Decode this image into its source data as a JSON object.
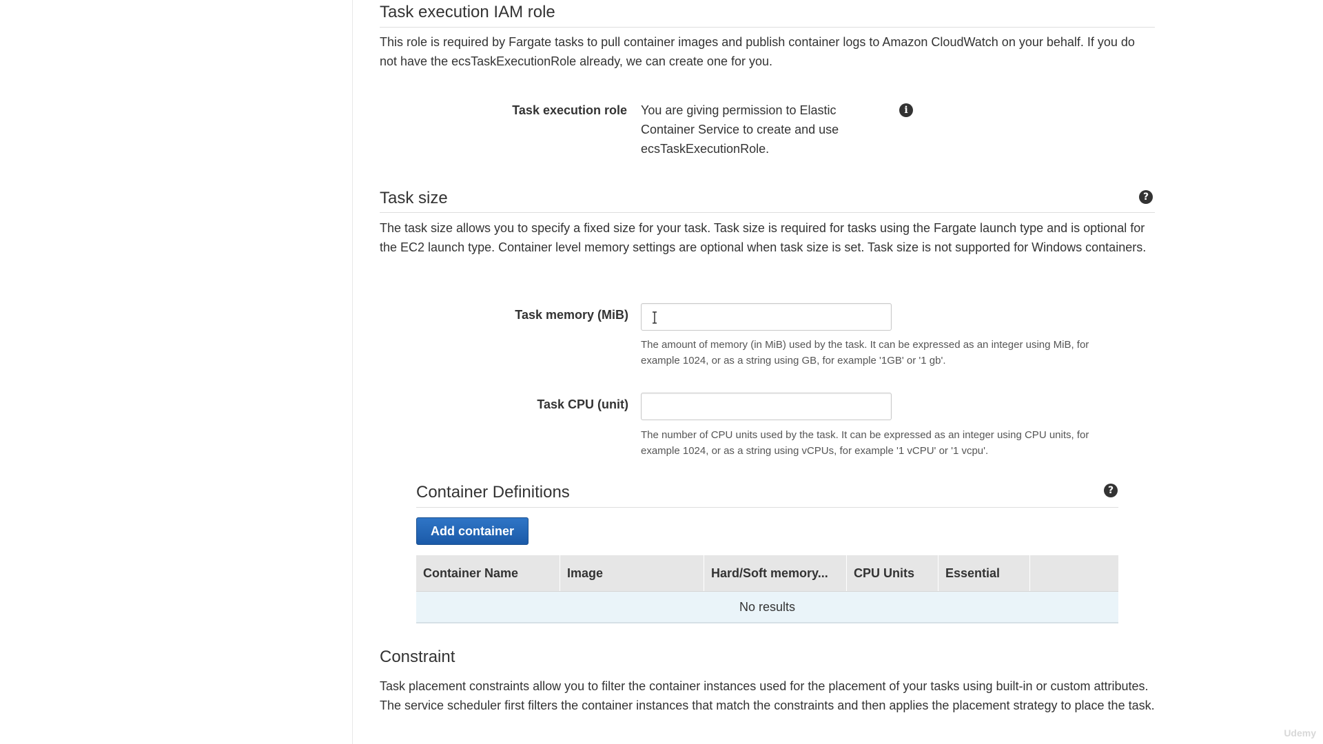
{
  "iam_section": {
    "heading": "Task execution IAM role",
    "description": "This role is required by Fargate tasks to pull container images and publish container logs to Amazon CloudWatch on your behalf. If you do not have the ecsTaskExecutionRole already, we can create one for you.",
    "role_label": "Task execution role",
    "role_text": "You are giving permission to Elastic Container Service to create and use ecsTaskExecutionRole.",
    "info_icon": "info-icon"
  },
  "task_size": {
    "heading": "Task size",
    "help_icon": "help-icon",
    "description": "The task size allows you to specify a fixed size for your task. Task size is required for tasks using the Fargate launch type and is optional for the EC2 launch type. Container level memory settings are optional when task size is set. Task size is not supported for Windows containers.",
    "memory": {
      "label": "Task memory (MiB)",
      "value": "",
      "help": "The amount of memory (in MiB) used by the task. It can be expressed as an integer using MiB, for example 1024, or as a string using GB, for example '1GB' or '1 gb'."
    },
    "cpu": {
      "label": "Task CPU (unit)",
      "value": "",
      "help": "The number of CPU units used by the task. It can be expressed as an integer using CPU units, for example 1024, or as a string using vCPUs, for example '1 vCPU' or '1 vcpu'."
    }
  },
  "container_definitions": {
    "heading": "Container Definitions",
    "help_icon": "help-icon",
    "add_button": "Add container",
    "columns": [
      "Container Name",
      "Image",
      "Hard/Soft memory...",
      "CPU Units",
      "Essential",
      ""
    ],
    "empty_text": "No results"
  },
  "constraint": {
    "heading": "Constraint",
    "description": "Task placement constraints allow you to filter the container instances used for the placement of your tasks using built-in or custom attributes. The service scheduler first filters the container instances that match the constraints and then applies the placement strategy to place the task."
  },
  "watermark": "Udemy",
  "colors": {
    "primary_button": "#1b5aa8",
    "table_header": "#e6e6e6",
    "empty_row": "#eaf4f9",
    "text": "#333333"
  }
}
